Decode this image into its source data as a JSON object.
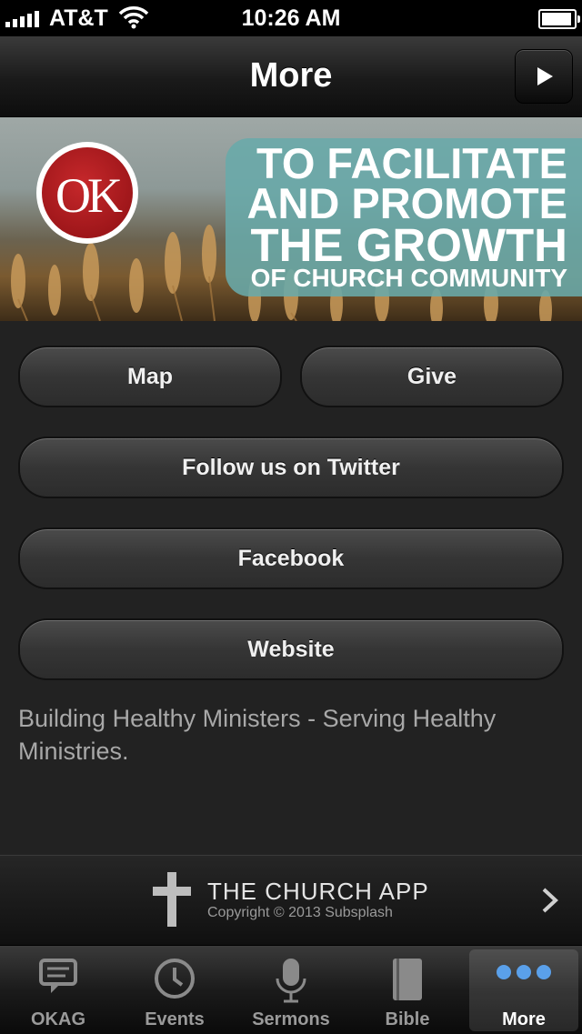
{
  "status": {
    "carrier": "AT&T",
    "time": "10:26 AM"
  },
  "navbar": {
    "title": "More"
  },
  "banner": {
    "logo_text": "OK",
    "tagline": [
      "TO FACILITATE",
      "AND PROMOTE",
      "THE GROWTH",
      "OF CHURCH COMMUNITY"
    ]
  },
  "buttons": {
    "map": "Map",
    "give": "Give",
    "twitter": "Follow us on Twitter",
    "facebook": "Facebook",
    "website": "Website"
  },
  "description": "Building Healthy Ministers - Serving Healthy Ministries.",
  "footer": {
    "app_title": "THE CHURCH APP",
    "copyright": "Copyright © 2013 Subsplash"
  },
  "tabs": [
    {
      "label": "OKAG",
      "icon": "chat-bubble-icon"
    },
    {
      "label": "Events",
      "icon": "clock-icon"
    },
    {
      "label": "Sermons",
      "icon": "microphone-icon"
    },
    {
      "label": "Bible",
      "icon": "book-icon"
    },
    {
      "label": "More",
      "icon": "more-dots-icon",
      "active": true
    }
  ],
  "colors": {
    "banner_overlay": "#69aaaa",
    "logo_red": "#b31c20",
    "active_dot": "#4a90e2"
  }
}
